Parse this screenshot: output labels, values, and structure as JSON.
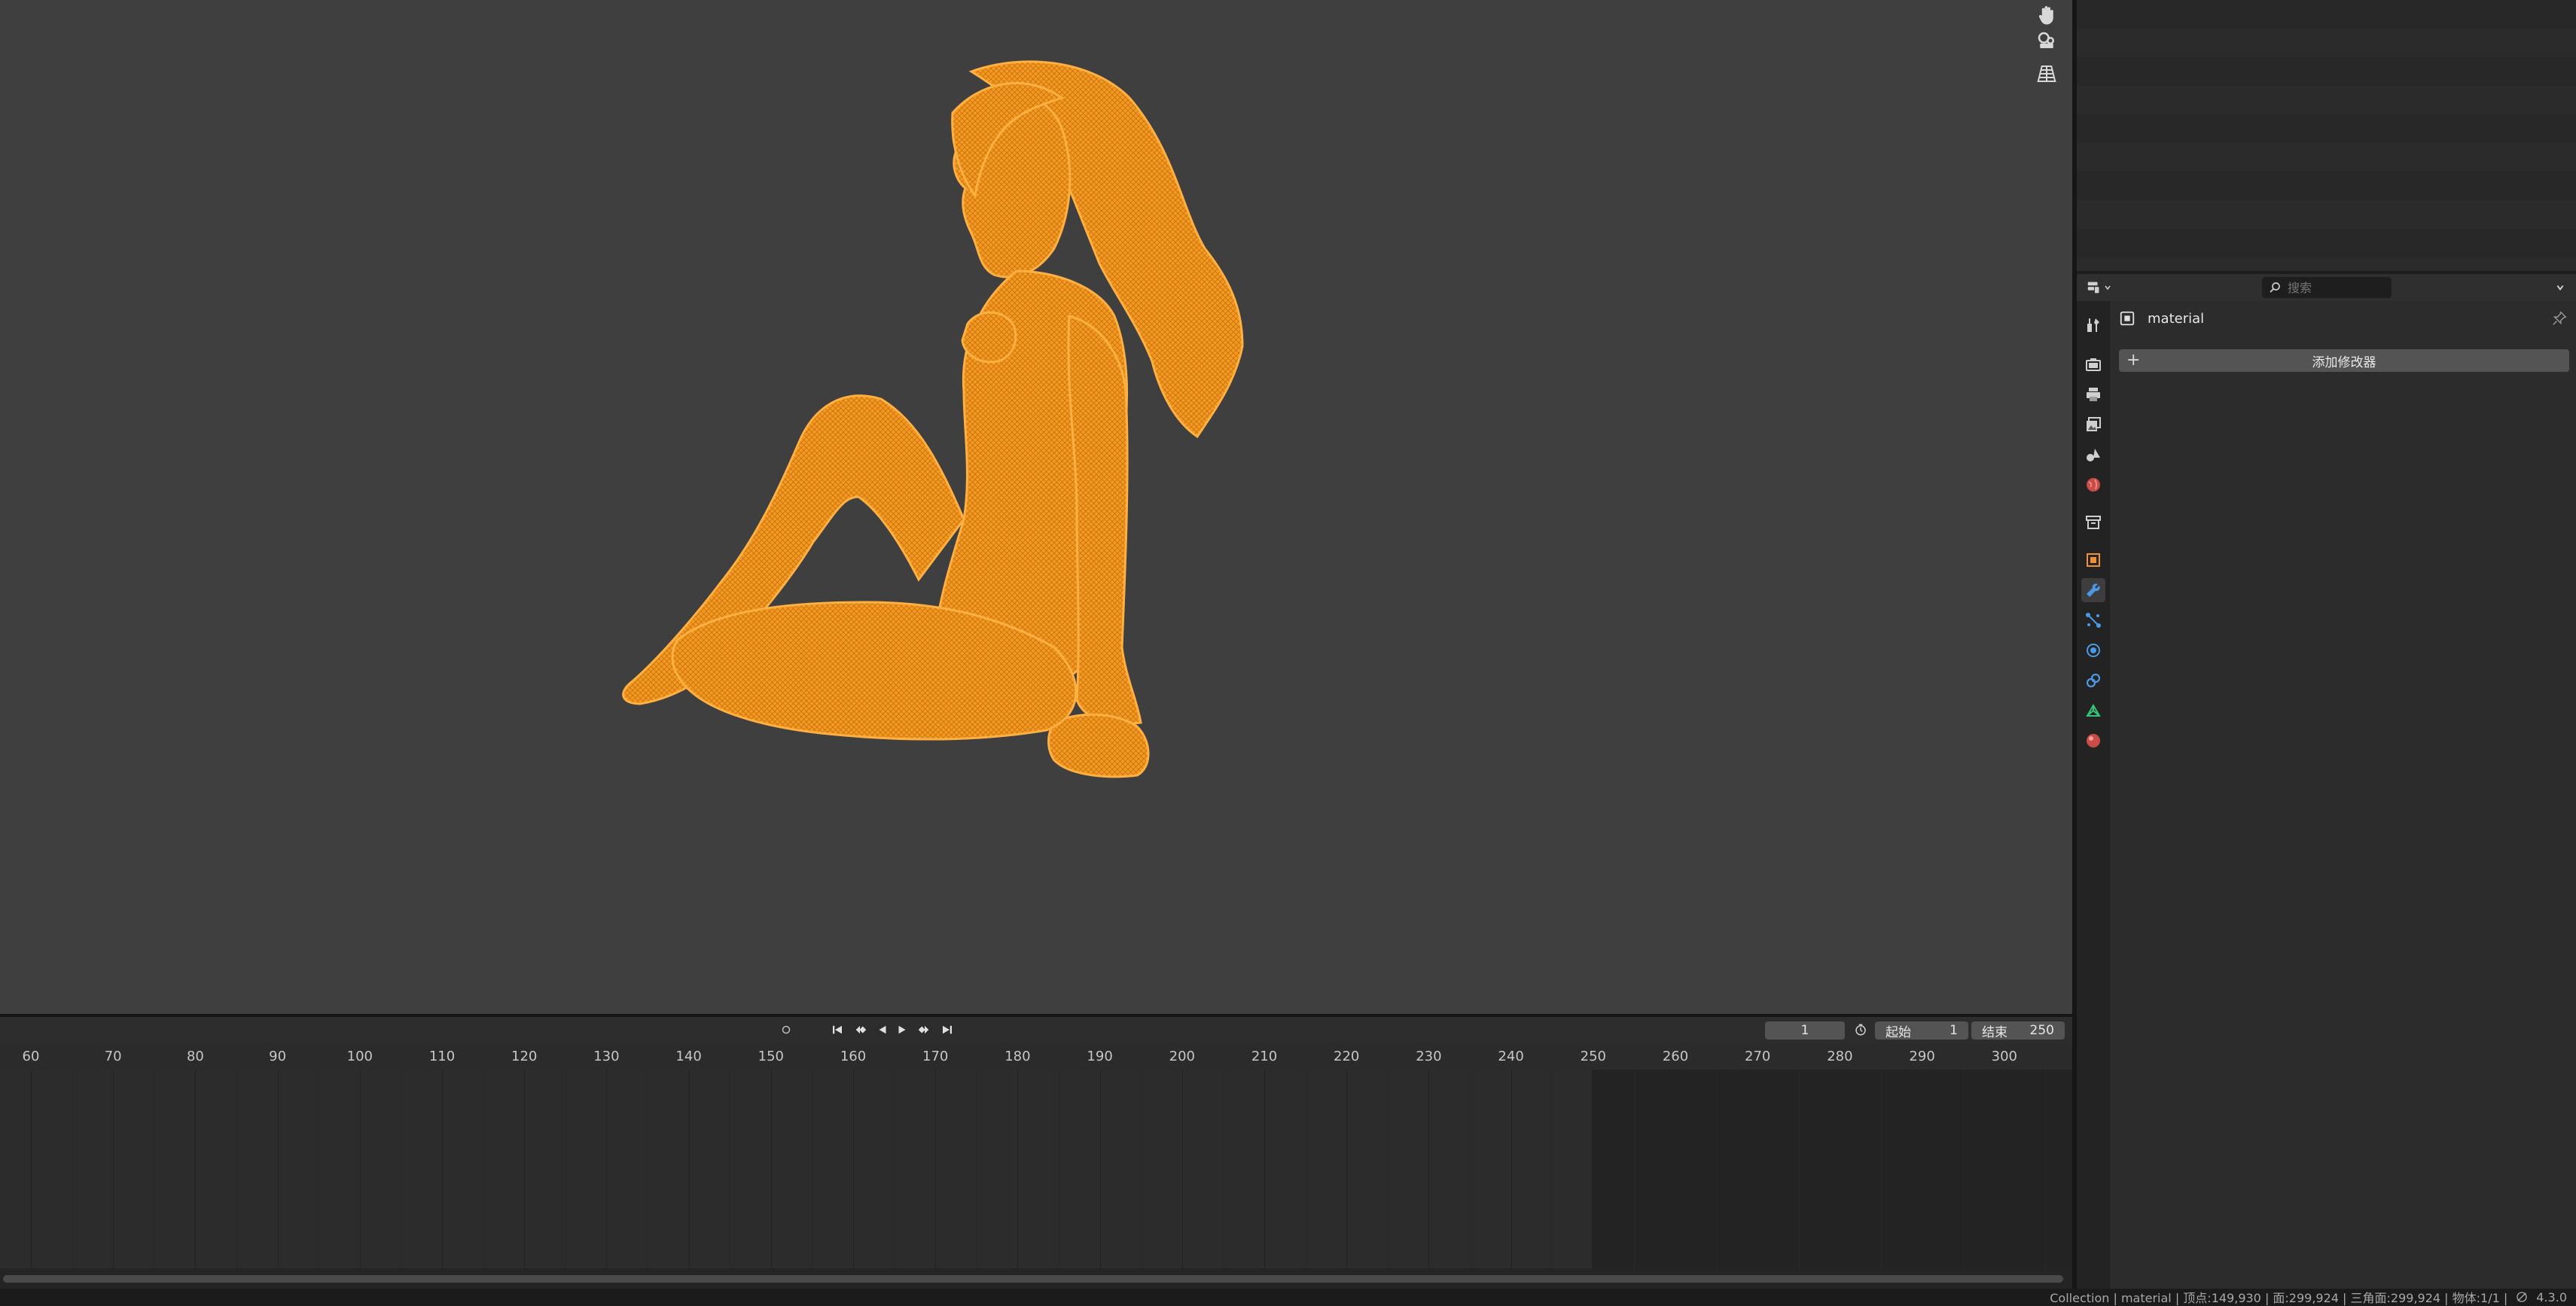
{
  "viewport": {
    "object_color": "#f39a23",
    "nav_icons": [
      "hand-pan-icon",
      "camera-view-icon",
      "grid-perspective-icon"
    ]
  },
  "timeline": {
    "current_frame": "1",
    "start_label": "起始",
    "start_value": "1",
    "end_label": "结束",
    "end_value": "250",
    "ruler_labels": [
      "60",
      "70",
      "80",
      "90",
      "100",
      "110",
      "120",
      "130",
      "140",
      "150",
      "160",
      "170",
      "180",
      "190",
      "200",
      "210",
      "220",
      "230",
      "240",
      "250",
      "260",
      "270",
      "280",
      "290",
      "300"
    ],
    "playback_icons": [
      "jump-to-start-icon",
      "jump-keyframe-back-icon",
      "play-reverse-icon",
      "play-icon",
      "jump-keyframe-forward-icon",
      "jump-to-end-icon"
    ]
  },
  "properties": {
    "search_placeholder": "搜索",
    "object_name": "material",
    "add_modifier_label": "添加修改器",
    "tabs": [
      "tool",
      "render",
      "output",
      "view-layer",
      "scene",
      "world",
      "collection",
      "object",
      "modifiers",
      "particles",
      "physics",
      "constraints",
      "data",
      "material"
    ],
    "active_tab": "modifiers"
  },
  "statusbar": {
    "text": "Collection | material | 顶点:149,930 | 面:299,924 | 三角面:299,924 | 物体:1/1 |",
    "version": "4.3.0"
  },
  "colors": {
    "accent": "#f39a23",
    "viewport_bg": "#3f3f3f",
    "panel_bg": "#2c2c2c"
  }
}
